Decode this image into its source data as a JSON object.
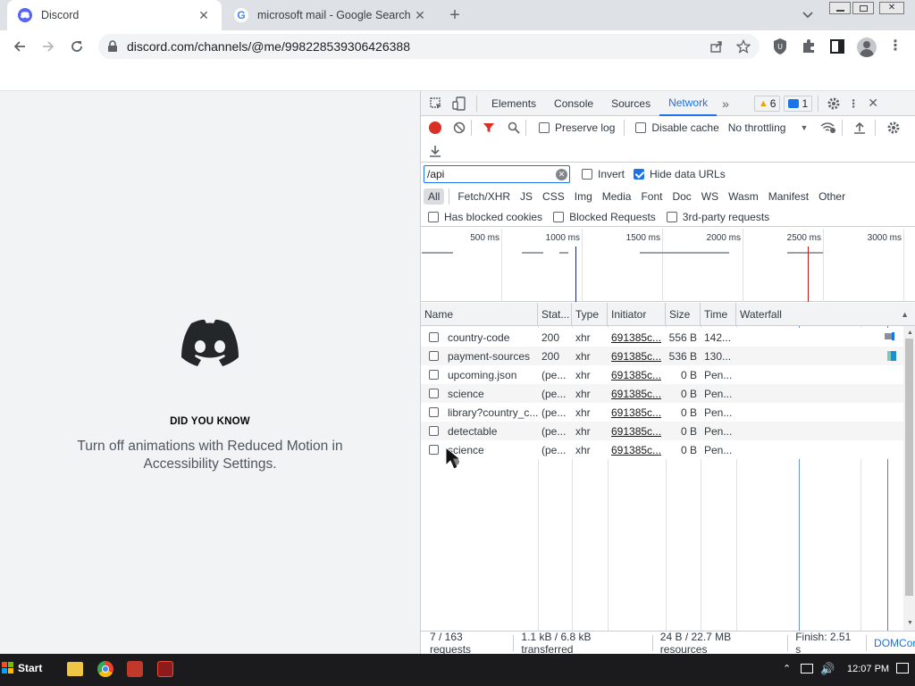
{
  "browser": {
    "tabs": [
      {
        "title": "Discord",
        "favicon": "discord-icon",
        "active": true
      },
      {
        "title": "microsoft mail - Google Search",
        "favicon": "google-icon",
        "active": false
      }
    ],
    "address": "discord.com/channels/@me/998228539306426388"
  },
  "discord": {
    "did_you_know_heading": "DID YOU KNOW",
    "tip_line1": "Turn off animations with Reduced Motion in",
    "tip_line2": "Accessibility Settings.",
    "brand_color": "#23272a"
  },
  "devtools": {
    "tabs": [
      "Elements",
      "Console",
      "Sources",
      "Network"
    ],
    "selected_tab": "Network",
    "warnings_count": "6",
    "messages_count": "1",
    "preserve_log": "Preserve log",
    "disable_cache": "Disable cache",
    "throttling": "No throttling",
    "filter_value": "/api",
    "invert": "Invert",
    "hide_data_urls": "Hide data URLs",
    "types": [
      "All",
      "Fetch/XHR",
      "JS",
      "CSS",
      "Img",
      "Media",
      "Font",
      "Doc",
      "WS",
      "Wasm",
      "Manifest",
      "Other"
    ],
    "has_blocked_cookies": "Has blocked cookies",
    "blocked_requests": "Blocked Requests",
    "third_party": "3rd-party requests",
    "timeline_ticks": [
      "500 ms",
      "1000 ms",
      "1500 ms",
      "2000 ms",
      "2500 ms",
      "3000 ms"
    ],
    "columns": [
      "Name",
      "Stat...",
      "Type",
      "Initiator",
      "Size",
      "Time",
      "Waterfall"
    ],
    "requests": [
      {
        "name": "country-code",
        "status": "200",
        "type": "xhr",
        "initiator": "691385c...",
        "size": "556 B",
        "time": "142..."
      },
      {
        "name": "payment-sources",
        "status": "200",
        "type": "xhr",
        "initiator": "691385c...",
        "size": "536 B",
        "time": "130..."
      },
      {
        "name": "upcoming.json",
        "status": "(pe...",
        "type": "xhr",
        "initiator": "691385c...",
        "size": "0 B",
        "time": "Pen..."
      },
      {
        "name": "science",
        "status": "(pe...",
        "type": "xhr",
        "initiator": "691385c...",
        "size": "0 B",
        "time": "Pen..."
      },
      {
        "name": "library?country_c...",
        "status": "(pe...",
        "type": "xhr",
        "initiator": "691385c...",
        "size": "0 B",
        "time": "Pen..."
      },
      {
        "name": "detectable",
        "status": "(pe...",
        "type": "xhr",
        "initiator": "691385c...",
        "size": "0 B",
        "time": "Pen..."
      },
      {
        "name": "science",
        "status": "(pe...",
        "type": "xhr",
        "initiator": "691385c...",
        "size": "0 B",
        "time": "Pen..."
      }
    ],
    "status_bar": {
      "requests": "7 / 163 requests",
      "transferred": "1.1 kB / 6.8 kB transferred",
      "resources": "24 B / 22.7 MB resources",
      "finish": "Finish: 2.51 s",
      "domcontent": "DOMCor"
    }
  },
  "taskbar": {
    "start": "Start",
    "clock": "12:07 PM"
  }
}
